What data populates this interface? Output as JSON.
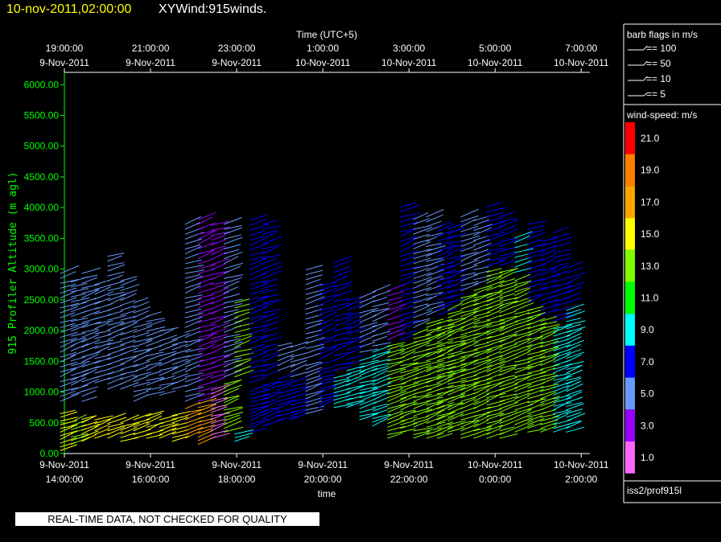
{
  "header": {
    "datetime": "10-nov-2011,02:00:00",
    "product": "XYWind:915winds."
  },
  "notice": "REAL-TIME DATA, NOT CHECKED FOR QUALITY",
  "colors": {
    "background": "#000000",
    "axis_y": "#00ff00",
    "title_datetime": "#ffff00",
    "text": "#ffffff"
  },
  "chart_data": {
    "type": "wind-barb-time-height",
    "ylabel": "915 Profiler Altitude (m agl)",
    "ylim": [
      0,
      6200
    ],
    "yticks": [
      "0.00",
      "500.00",
      "1000.00",
      "1500.00",
      "2000.00",
      "2500.00",
      "3000.00",
      "3500.00",
      "4000.00",
      "4500.00",
      "5000.00",
      "5500.00",
      "6000.00"
    ],
    "ytick_values": [
      0,
      500,
      1000,
      1500,
      2000,
      2500,
      3000,
      3500,
      4000,
      4500,
      5000,
      5500,
      6000
    ],
    "xlabel_bottom": "time",
    "xlabel_top": "Time (UTC+5)",
    "xlim_hours": [
      14,
      26.2
    ],
    "bottom_ticks": [
      {
        "hour": 14,
        "date": "9-Nov-2011",
        "time": "14:00:00"
      },
      {
        "hour": 16,
        "date": "9-Nov-2011",
        "time": "16:00:00"
      },
      {
        "hour": 18,
        "date": "9-Nov-2011",
        "time": "18:00:00"
      },
      {
        "hour": 20,
        "date": "9-Nov-2011",
        "time": "20:00:00"
      },
      {
        "hour": 22,
        "date": "9-Nov-2011",
        "time": "22:00:00"
      },
      {
        "hour": 24,
        "date": "10-Nov-2011",
        "time": "0:00:00"
      },
      {
        "hour": 26,
        "date": "10-Nov-2011",
        "time": "2:00:00"
      }
    ],
    "top_ticks": [
      {
        "hour": 14,
        "time": "19:00:00",
        "date": "9-Nov-2011"
      },
      {
        "hour": 16,
        "time": "21:00:00",
        "date": "9-Nov-2011"
      },
      {
        "hour": 18,
        "time": "23:00:00",
        "date": "9-Nov-2011"
      },
      {
        "hour": 20,
        "time": "1:00:00",
        "date": "10-Nov-2011"
      },
      {
        "hour": 22,
        "time": "3:00:00",
        "date": "10-Nov-2011"
      },
      {
        "hour": 24,
        "time": "5:00:00",
        "date": "10-Nov-2011"
      },
      {
        "hour": 26,
        "time": "7:00:00",
        "date": "10-Nov-2011"
      }
    ],
    "barb_legend": {
      "title": "barb flags in m/s",
      "items": [
        "== 100",
        "== 50",
        "== 10",
        "== 5"
      ]
    },
    "speed_legend": {
      "title": "wind-speed: m/s",
      "levels": [
        {
          "label": "21.0",
          "color": "#ff0000"
        },
        {
          "label": "19.0",
          "color": "#ff8000"
        },
        {
          "label": "17.0",
          "color": "#ffa500"
        },
        {
          "label": "15.0",
          "color": "#ffff00"
        },
        {
          "label": "13.0",
          "color": "#80ff00"
        },
        {
          "label": "11.0",
          "color": "#00ff00"
        },
        {
          "label": "9.0",
          "color": "#00ffff"
        },
        {
          "label": "7.0",
          "color": "#0000ff"
        },
        {
          "label": "5.0",
          "color": "#6699ff"
        },
        {
          "label": "3.0",
          "color": "#9900ff"
        },
        {
          "label": "1.0",
          "color": "#ff66ff"
        }
      ]
    },
    "source": "iss2/prof915l",
    "profiles": [
      {
        "t": 14.05,
        "low": [
          100,
          700
        ],
        "mid": [
          900,
          3000
        ],
        "top": 3000,
        "lowc": "#ffff00",
        "midc": "#6699ff"
      },
      {
        "t": 14.3,
        "low": [
          200,
          600
        ],
        "mid": [
          1000,
          2900
        ],
        "top": 2900,
        "lowc": "#80ff00",
        "midc": "#6699ff"
      },
      {
        "t": 14.55,
        "low": [
          250,
          650
        ],
        "mid": [
          900,
          3000
        ],
        "top": 3000,
        "lowc": "#ffff00",
        "midc": "#6699ff"
      },
      {
        "t": 14.85,
        "low": [
          300,
          600
        ],
        "mid": [
          1200,
          2800
        ],
        "top": 2800,
        "lowc": "#ffff00",
        "midc": "#6699ff"
      },
      {
        "t": 15.15,
        "low": [
          300,
          650
        ],
        "mid": [
          1100,
          3300
        ],
        "top": 3300,
        "lowc": "#ffff00",
        "midc": "#6699ff"
      },
      {
        "t": 15.45,
        "low": [
          250,
          600
        ],
        "mid": [
          1100,
          2900
        ],
        "top": 2900,
        "lowc": "#ffff00",
        "midc": "#6699ff"
      },
      {
        "t": 15.75,
        "low": [
          300,
          650
        ],
        "mid": [
          900,
          2500
        ],
        "top": 2500,
        "lowc": "#ffff00",
        "midc": "#6699ff"
      },
      {
        "t": 16.05,
        "low": [
          300,
          700
        ],
        "mid": [
          1000,
          2300
        ],
        "top": 2300,
        "lowc": "#ffff00",
        "midc": "#6699ff"
      },
      {
        "t": 16.35,
        "low": [
          300,
          650
        ],
        "mid": [
          1000,
          2100
        ],
        "top": 2100,
        "lowc": "#ffff00",
        "midc": "#6699ff"
      },
      {
        "t": 16.65,
        "low": [
          250,
          700
        ],
        "mid": [
          1100,
          1900
        ],
        "top": 1900,
        "lowc": "#ffff00",
        "midc": "#6699ff"
      },
      {
        "t": 16.95,
        "low": [
          300,
          800
        ],
        "mid": [
          900,
          3800
        ],
        "top": 3800,
        "lowc": "#ffa500",
        "midc": "#6699ff"
      },
      {
        "t": 17.25,
        "low": [
          200,
          900
        ],
        "mid": [
          900,
          3900
        ],
        "top": 3900,
        "lowc": "#ffa500",
        "midc": "#9900ff"
      },
      {
        "t": 17.55,
        "low": [
          300,
          1100
        ],
        "mid": [
          1200,
          3800
        ],
        "top": 3800,
        "lowc": "#ff66ff",
        "midc": "#9900ff"
      },
      {
        "t": 17.85,
        "low": [
          400,
          1200
        ],
        "mid": [
          1300,
          3800
        ],
        "top": 3800,
        "lowc": "#80ff00",
        "midc": "#6699ff"
      },
      {
        "t": 18.1,
        "low": [
          250,
          400
        ],
        "mid": [
          1300,
          2500
        ],
        "top": 2500,
        "lowc": "#00ffff",
        "midc": "#80ff00"
      },
      {
        "t": 18.45,
        "low": [
          400,
          1100
        ],
        "mid": [
          1200,
          3900
        ],
        "top": 3900,
        "lowc": "#0000ff",
        "midc": "#0000ff"
      },
      {
        "t": 18.75,
        "low": [
          500,
          1200
        ],
        "mid": [
          1300,
          3800
        ],
        "top": 3800,
        "lowc": "#0000ff",
        "midc": "#0000ff"
      },
      {
        "t": 19.1,
        "low": [
          600,
          1300
        ],
        "mid": [
          1400,
          1800
        ],
        "top": 1800,
        "lowc": "#0000ff",
        "midc": "#6699ff"
      },
      {
        "t": 19.4,
        "low": [
          600,
          1200
        ],
        "mid": [
          1300,
          1800
        ],
        "top": 1800,
        "lowc": "#0000ff",
        "midc": "#6699ff"
      },
      {
        "t": 19.75,
        "low": [
          700,
          1500
        ],
        "mid": [
          1600,
          3100
        ],
        "top": 3100,
        "lowc": "#6699ff",
        "midc": "#6699ff"
      },
      {
        "t": 20.05,
        "low": [
          800,
          1400
        ],
        "mid": [
          1500,
          2800
        ],
        "top": 2800,
        "lowc": "#0000ff",
        "midc": "#0000ff"
      },
      {
        "t": 20.4,
        "low": [
          800,
          1300
        ],
        "mid": [
          1400,
          3200
        ],
        "top": 3200,
        "lowc": "#00ffff",
        "midc": "#0000ff"
      },
      {
        "t": 20.7,
        "low": [
          800,
          1400
        ],
        "mid": [
          1500,
          2600
        ],
        "top": 2600,
        "lowc": "#00ffff",
        "midc": "#0000ff"
      },
      {
        "t": 21.0,
        "low": [
          600,
          1600
        ],
        "mid": [
          1700,
          2600
        ],
        "top": 2600,
        "lowc": "#00ffff",
        "midc": "#6699ff"
      },
      {
        "t": 21.3,
        "low": [
          500,
          1700
        ],
        "mid": [
          1800,
          2700
        ],
        "top": 2700,
        "lowc": "#00ffff",
        "midc": "#6699ff"
      },
      {
        "t": 21.65,
        "low": [
          300,
          1800
        ],
        "mid": [
          1900,
          2700
        ],
        "top": 2700,
        "lowc": "#80ff00",
        "midc": "#9900ff"
      },
      {
        "t": 21.95,
        "low": [
          400,
          1800
        ],
        "mid": [
          1900,
          4100
        ],
        "top": 4100,
        "lowc": "#80ff00",
        "midc": "#0000ff"
      },
      {
        "t": 22.25,
        "low": [
          300,
          2000
        ],
        "mid": [
          2100,
          3900
        ],
        "top": 3900,
        "lowc": "#80ff00",
        "midc": "#6699ff"
      },
      {
        "t": 22.55,
        "low": [
          300,
          2200
        ],
        "mid": [
          2300,
          3900
        ],
        "top": 3900,
        "lowc": "#80ff00",
        "midc": "#6699ff"
      },
      {
        "t": 22.8,
        "low": [
          300,
          2200
        ],
        "mid": [
          2300,
          3800
        ],
        "top": 3800,
        "lowc": "#80ff00",
        "midc": "#0000ff"
      },
      {
        "t": 23.05,
        "low": [
          400,
          2400
        ],
        "mid": [
          2500,
          3700
        ],
        "top": 3700,
        "lowc": "#80ff00",
        "midc": "#0000ff"
      },
      {
        "t": 23.35,
        "low": [
          300,
          2600
        ],
        "mid": [
          2700,
          3900
        ],
        "top": 3900,
        "lowc": "#80ff00",
        "midc": "#6699ff"
      },
      {
        "t": 23.65,
        "low": [
          300,
          2700
        ],
        "mid": [
          2800,
          3900
        ],
        "top": 3900,
        "lowc": "#80ff00",
        "midc": "#6699ff"
      },
      {
        "t": 23.95,
        "low": [
          300,
          3000
        ],
        "mid": [
          3100,
          4100
        ],
        "top": 4100,
        "lowc": "#80ff00",
        "midc": "#0000ff"
      },
      {
        "t": 24.25,
        "low": [
          300,
          3000
        ],
        "mid": [
          3100,
          3900
        ],
        "top": 3900,
        "lowc": "#80ff00",
        "midc": "#0000ff"
      },
      {
        "t": 24.6,
        "low": [
          400,
          2900
        ],
        "mid": [
          3000,
          3600
        ],
        "top": 3600,
        "lowc": "#80ff00",
        "midc": "#00ffff"
      },
      {
        "t": 24.9,
        "low": [
          400,
          2400
        ],
        "mid": [
          2500,
          3800
        ],
        "top": 3800,
        "lowc": "#80ff00",
        "midc": "#0000ff"
      },
      {
        "t": 25.2,
        "low": [
          400,
          2200
        ],
        "mid": [
          2300,
          3500
        ],
        "top": 3500,
        "lowc": "#80ff00",
        "midc": "#0000ff"
      },
      {
        "t": 25.5,
        "low": [
          400,
          2100
        ],
        "mid": [
          2200,
          3700
        ],
        "top": 3700,
        "lowc": "#00ffff",
        "midc": "#0000ff"
      },
      {
        "t": 25.8,
        "low": [
          400,
          2400
        ],
        "mid": [
          2500,
          3100
        ],
        "top": 3100,
        "lowc": "#00ffff",
        "midc": "#0000ff"
      }
    ]
  }
}
